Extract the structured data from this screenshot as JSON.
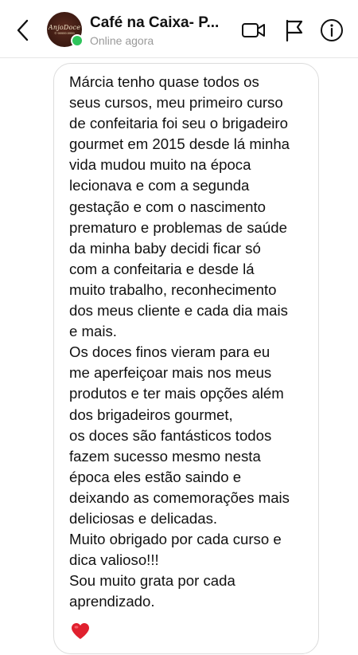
{
  "header": {
    "title": "Café na Caixa- P...",
    "status": "Online agora",
    "avatar": {
      "brand": "AnjoDoce",
      "sub": "© 99999.9999"
    },
    "icons": {
      "back": "chevron-left-icon",
      "video": "video-camera-icon",
      "flag": "flag-icon",
      "info": "info-icon"
    }
  },
  "message": {
    "text": "Márcia tenho quase todos os\nseus cursos, meu primeiro curso\nde confeitaria foi seu o brigadeiro\ngourmet em 2015 desde lá minha\nvida mudou muito na época\nlecionava e com a segunda\ngestação e com o nascimento\nprematuro e problemas de saúde\nda minha baby decidi ficar só\ncom a confeitaria e desde lá\nmuito trabalho, reconhecimento\ndos meus cliente e cada dia mais\ne mais.\nOs doces finos vieram para eu\nme aperfeiçoar mais nos meus\nprodutos e ter mais opções além\ndos brigadeiros gourmet,\nos doces são fantásticos todos\nfazem sucesso mesmo nesta\népoca eles estão saindo e\ndeixando as comemorações mais\ndeliciosas e delicadas.\nMuito obrigado por cada curso e\ndica valioso!!!\nSou muito grata por cada\naprendizado.",
    "reaction": "heart-emoji"
  },
  "colors": {
    "online": "#2ec45b",
    "heart": "#e0202e",
    "status_text": "#9a9a9a"
  }
}
